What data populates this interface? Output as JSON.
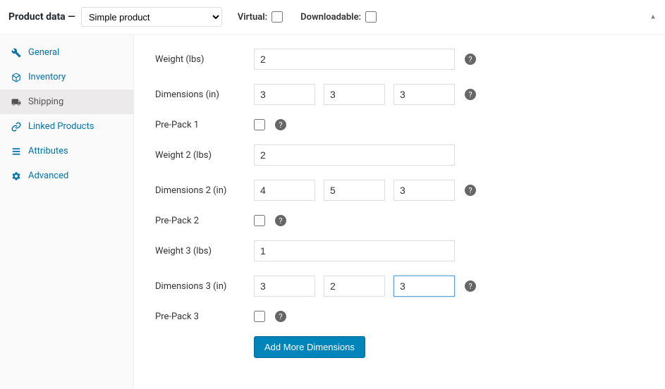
{
  "header": {
    "title": "Product data —",
    "product_type": "Simple product",
    "virtual_label": "Virtual:",
    "virtual_checked": false,
    "downloadable_label": "Downloadable:",
    "downloadable_checked": false
  },
  "sidebar": {
    "items": [
      {
        "id": "general",
        "label": "General",
        "icon": "wrench"
      },
      {
        "id": "inventory",
        "label": "Inventory",
        "icon": "package"
      },
      {
        "id": "shipping",
        "label": "Shipping",
        "icon": "truck",
        "active": true
      },
      {
        "id": "linked",
        "label": "Linked Products",
        "icon": "link"
      },
      {
        "id": "attributes",
        "label": "Attributes",
        "icon": "list"
      },
      {
        "id": "advanced",
        "label": "Advanced",
        "icon": "gear"
      }
    ]
  },
  "form": {
    "weight_label": "Weight (lbs)",
    "weight_value": "2",
    "dimensions_label": "Dimensions (in)",
    "dimensions_value": {
      "l": "3",
      "w": "3",
      "h": "3"
    },
    "prepack1_label": "Pre-Pack 1",
    "prepack1_checked": false,
    "weight2_label": "Weight 2 (lbs)",
    "weight2_value": "2",
    "dimensions2_label": "Dimensions 2 (in)",
    "dimensions2_value": {
      "l": "4",
      "w": "5",
      "h": "3"
    },
    "prepack2_label": "Pre-Pack 2",
    "prepack2_checked": false,
    "weight3_label": "Weight 3 (lbs)",
    "weight3_value": "1",
    "dimensions3_label": "Dimensions 3 (in)",
    "dimensions3_value": {
      "l": "3",
      "w": "2",
      "h": "3"
    },
    "prepack3_label": "Pre-Pack 3",
    "prepack3_checked": false,
    "add_button": "Add More Dimensions"
  },
  "icons": {
    "help": "?"
  }
}
